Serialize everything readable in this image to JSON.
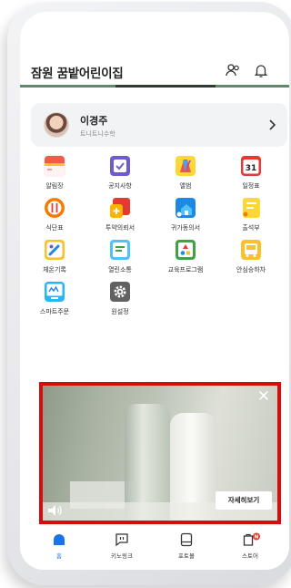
{
  "header": {
    "title": "잠원 꿈밭어린이집"
  },
  "profile": {
    "name": "이경주",
    "class": "트니트니수학"
  },
  "menu": [
    {
      "label": "알림장",
      "icon": "notebook-icon"
    },
    {
      "label": "공지사항",
      "icon": "checkbox-icon"
    },
    {
      "label": "앨범",
      "icon": "album-icon"
    },
    {
      "label": "일정표",
      "icon": "calendar-icon"
    },
    {
      "label": "식단표",
      "icon": "utensils-icon"
    },
    {
      "label": "투약의뢰서",
      "icon": "medicine-icon"
    },
    {
      "label": "귀가동의서",
      "icon": "home-return-icon"
    },
    {
      "label": "출석부",
      "icon": "attendance-icon"
    },
    {
      "label": "체온기록",
      "icon": "thermometer-icon"
    },
    {
      "label": "열린소통",
      "icon": "chat-board-icon"
    },
    {
      "label": "교육프로그램",
      "icon": "shapes-icon"
    },
    {
      "label": "안심승하차",
      "icon": "bus-icon"
    },
    {
      "label": "스마트주문",
      "icon": "smart-order-icon"
    },
    {
      "label": "원설정",
      "icon": "settings-icon"
    }
  ],
  "calendar_day": "31",
  "ad": {
    "button_label": "자세히보기"
  },
  "tabs": [
    {
      "label": "홈",
      "icon": "home-icon"
    },
    {
      "label": "키노링크",
      "icon": "kinolink-icon"
    },
    {
      "label": "포토몰",
      "icon": "photo-mall-icon"
    },
    {
      "label": "스토어",
      "icon": "store-icon"
    }
  ],
  "store_badge": "N",
  "colors": {
    "active_tab": "#1a73e8",
    "ad_border": "#d80c0c",
    "badge": "#e8372c"
  }
}
